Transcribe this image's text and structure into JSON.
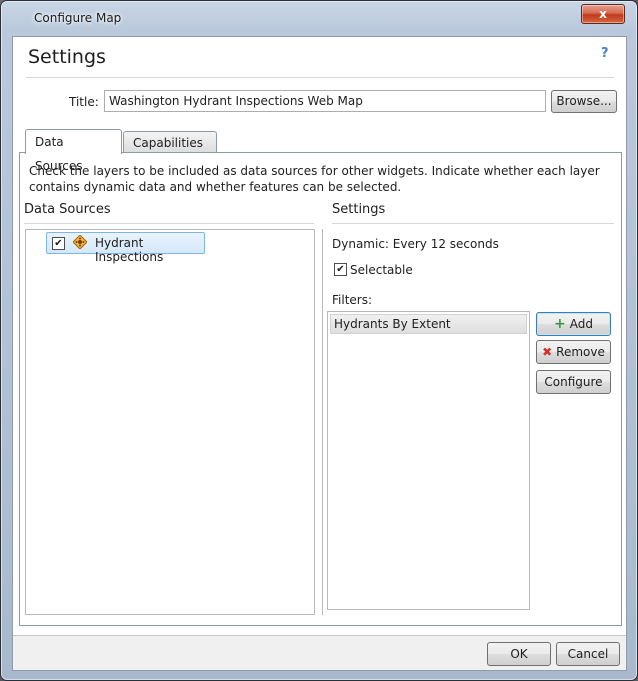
{
  "window": {
    "title": "Configure Map",
    "close_glyph": "x"
  },
  "header": {
    "title": "Settings",
    "help": "?"
  },
  "title_field": {
    "label": "Title:",
    "value": "Washington Hydrant Inspections Web Map",
    "browse_label": "Browse..."
  },
  "tabs": [
    {
      "label": "Data Sources"
    },
    {
      "label": "Capabilities"
    }
  ],
  "panel": {
    "description": "Check the layers to be included as data sources for other widgets. Indicate whether each layer contains dynamic data and whether features can be selected.",
    "data_sources_heading": "Data Sources",
    "settings_heading": "Settings",
    "sources": [
      {
        "label": "Hydrant Inspections",
        "checked": true,
        "icon": "layer-icon"
      }
    ],
    "dynamic_text": "Dynamic: Every 12 seconds",
    "selectable_label": "Selectable",
    "selectable_checked": true,
    "filters_label": "Filters:",
    "filters": [
      "Hydrants By Extent"
    ],
    "add_label": "Add",
    "remove_label": "Remove",
    "configure_label": "Configure"
  },
  "footer": {
    "ok_label": "OK",
    "cancel_label": "Cancel"
  }
}
